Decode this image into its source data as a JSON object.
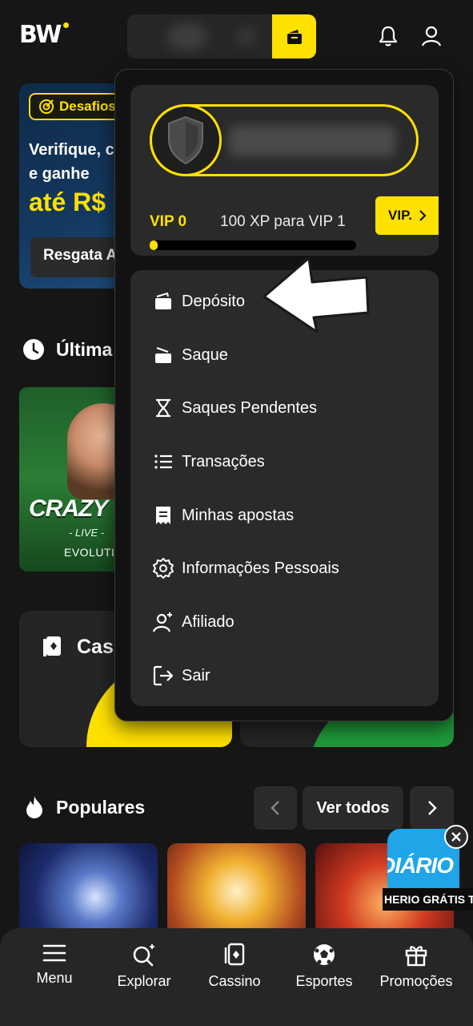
{
  "header": {
    "logo": "BW",
    "wallet_icon": "wallet-icon",
    "notification_icon": "bell-icon",
    "profile_icon": "user-icon"
  },
  "background": {
    "promo": {
      "tag": "Desafios",
      "line1": "Verifique, c",
      "line2": "e ganhe",
      "amount": "até R$",
      "button": "Resgata A"
    },
    "recent_title": "Última",
    "live_game": {
      "title": "CRAZY TI",
      "subtitle": "- LIVE -",
      "provider": "EVOLUTION"
    },
    "cassino_title": "Cas",
    "popular_title": "Populares",
    "ver_todos": "Ver todos",
    "diario": {
      "title": "DIÁRIO",
      "strip": "HERIO GRÁTIS  TE"
    }
  },
  "dropdown": {
    "vip_level": "VIP 0",
    "vip_xp": "100 XP para VIP 1",
    "vip_progress": 0.02,
    "vip_button": "VIP.",
    "menu": [
      {
        "label": "Depósito",
        "icon": "deposit-icon"
      },
      {
        "label": "Saque",
        "icon": "withdraw-icon"
      },
      {
        "label": "Saques Pendentes",
        "icon": "hourglass-icon"
      },
      {
        "label": "Transações",
        "icon": "list-icon"
      },
      {
        "label": "Minhas apostas",
        "icon": "ticket-icon"
      },
      {
        "label": "Informações Pessoais",
        "icon": "gear-icon"
      },
      {
        "label": "Afiliado",
        "icon": "user-plus-icon"
      },
      {
        "label": "Sair",
        "icon": "logout-icon"
      }
    ]
  },
  "bottom_nav": [
    {
      "label": "Menu",
      "icon": "hamburger-icon"
    },
    {
      "label": "Explorar",
      "icon": "search-sparkle-icon"
    },
    {
      "label": "Cassino",
      "icon": "cards-icon"
    },
    {
      "label": "Esportes",
      "icon": "soccer-ball-icon"
    },
    {
      "label": "Promoções",
      "icon": "gift-icon"
    }
  ],
  "colors": {
    "accent": "#ffe100",
    "background": "#161616",
    "panel": "#2a2a2a"
  }
}
